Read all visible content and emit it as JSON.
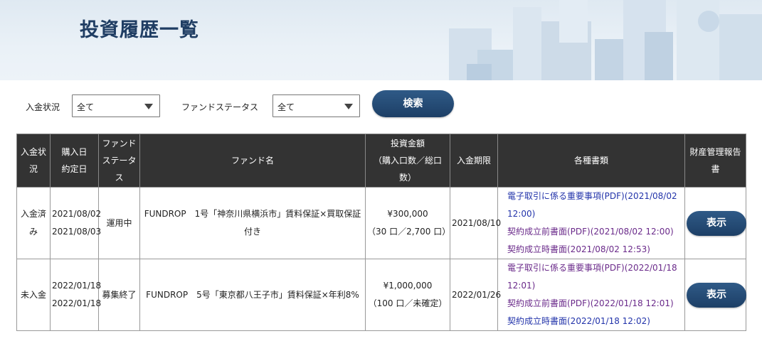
{
  "page": {
    "title": "投資履歴一覧"
  },
  "filters": {
    "deposit_status_label": "入金状況",
    "deposit_status_value": "全て",
    "fund_status_label": "ファンドステータス",
    "fund_status_value": "全て",
    "search_label": "検索"
  },
  "table": {
    "headers": {
      "deposit_status": "入金状況",
      "dates": "購入日\n約定日",
      "fund_status": "ファンドステータス",
      "fund_name": "ファンド名",
      "amount": "投資金額\n（購入口数／総口数）",
      "deposit_deadline": "入金期限",
      "documents": "各種書類",
      "property_report": "財産管理報告書"
    },
    "rows": [
      {
        "deposit_status": "入金済み",
        "purchase_date": "2021/08/02",
        "contract_date": "2021/08/03",
        "fund_status": "運用中",
        "fund_name": "FUNDROP　1号「神奈川県横浜市」賃料保証×買取保証付き",
        "amount": "¥300,000",
        "units": "（30 口／2,700 口）",
        "deposit_deadline": "2021/08/10",
        "documents": [
          "電子取引に係る重要事項(PDF)(2021/08/02 12:00)",
          "契約成立前書面(PDF)(2021/08/02 12:00)",
          "契約成立時書面(2021/08/02 12:53)"
        ],
        "view_label": "表示"
      },
      {
        "deposit_status": "未入金",
        "purchase_date": "2022/01/18",
        "contract_date": "2022/01/18",
        "fund_status": "募集終了",
        "fund_name": "FUNDROP　5号「東京都八王子市」賃料保証×年利8%",
        "amount": "¥1,000,000",
        "units": "（100 口／未確定）",
        "deposit_deadline": "2022/01/26",
        "documents": [
          "電子取引に係る重要事項(PDF)(2022/01/18 12:01)",
          "契約成立前書面(PDF)(2022/01/18 12:01)",
          "契約成立時書面(2022/01/18 12:02)"
        ],
        "view_label": "表示"
      }
    ]
  }
}
